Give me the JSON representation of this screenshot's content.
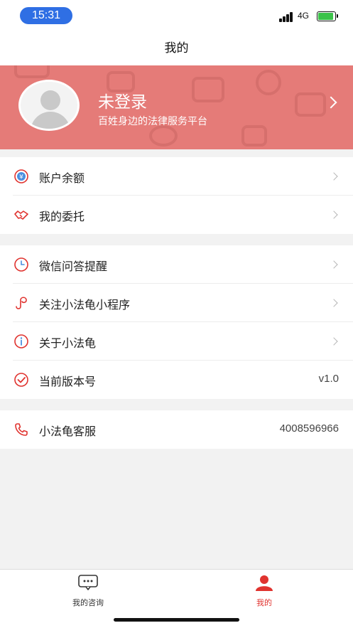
{
  "status_bar": {
    "time": "15:31",
    "network": "4G"
  },
  "nav": {
    "title": "我的"
  },
  "profile": {
    "name": "未登录",
    "slogan": "百姓身边的法律服务平台"
  },
  "group1": [
    {
      "label": "账户余额",
      "icon": "yen-circle-icon"
    },
    {
      "label": "我的委托",
      "icon": "handshake-icon"
    }
  ],
  "group2": [
    {
      "label": "微信问答提醒",
      "icon": "clock-icon"
    },
    {
      "label": "关注小法龟小程序",
      "icon": "mini-program-icon"
    },
    {
      "label": "关于小法龟",
      "icon": "info-icon"
    },
    {
      "label": "当前版本号",
      "icon": "check-circle-icon",
      "value": "v1.0"
    }
  ],
  "group3": [
    {
      "label": "小法龟客服",
      "icon": "phone-icon",
      "value": "4008596966"
    }
  ],
  "tabbar": {
    "tabs": [
      {
        "label": "我的咨询",
        "icon": "chat-bubble-icon"
      },
      {
        "label": "我的",
        "icon": "user-icon",
        "active": true
      }
    ]
  },
  "colors": {
    "accent": "#e0332f",
    "banner": "#e57b78",
    "time_pill": "#2f6fe4",
    "battery": "#3cc24a"
  }
}
